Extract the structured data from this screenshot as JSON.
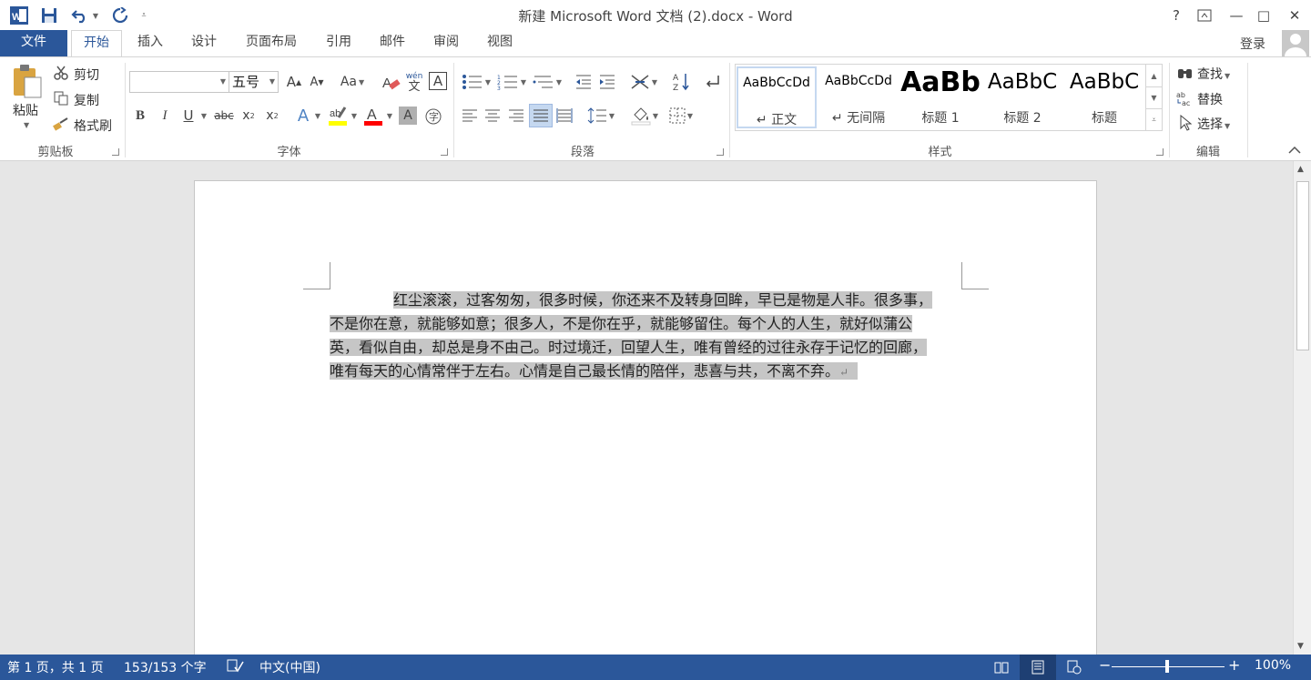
{
  "title": "新建 Microsoft Word 文档 (2).docx - Word",
  "window": {
    "help": "?",
    "minimize": "—",
    "maximize": "□",
    "close": "✕"
  },
  "tabs": [
    {
      "label": "文件"
    },
    {
      "label": "开始"
    },
    {
      "label": "插入"
    },
    {
      "label": "设计"
    },
    {
      "label": "页面布局"
    },
    {
      "label": "引用"
    },
    {
      "label": "邮件"
    },
    {
      "label": "审阅"
    },
    {
      "label": "视图"
    }
  ],
  "account": {
    "login": "登录"
  },
  "clipboard": {
    "group": "剪贴板",
    "paste": "粘贴",
    "cut": "剪切",
    "copy": "复制",
    "format_painter": "格式刷"
  },
  "font": {
    "group": "字体",
    "font_name": "",
    "font_size": "五号",
    "change_case": "Aa",
    "phonetic_top": "wén",
    "phonetic_bottom": "文"
  },
  "paragraph": {
    "group": "段落"
  },
  "styles": {
    "group": "样式",
    "items": [
      {
        "sample": "AaBbCcDd",
        "name": "↵ 正文"
      },
      {
        "sample": "AaBbCcDd",
        "name": "↵ 无间隔"
      },
      {
        "sample": "AaBb",
        "name": "标题 1"
      },
      {
        "sample": "AaBbC",
        "name": "标题 2"
      },
      {
        "sample": "AaBbC",
        "name": "标题"
      }
    ]
  },
  "editing": {
    "group": "编辑",
    "find": "查找",
    "replace": "替换",
    "select": "选择"
  },
  "document": {
    "lines": [
      "红尘滚滚，过客匆匆，很多时候，你还来不及转身回眸，早已是物是人非。很多事，",
      "不是你在意，就能够如意；很多人，不是你在乎，就能够留住。每个人的人生，就好似蒲公",
      "英，看似自由，却总是身不由己。时过境迁，回望人生，唯有曾经的过往永存于记忆的回廊，",
      "唯有每天的心情常伴于左右。心情是自己最长情的陪伴，悲喜与共，不离不弃。"
    ],
    "paragraph_mark": "↵"
  },
  "status": {
    "page": "第 1 页，共 1 页",
    "words": "153/153 个字",
    "language": "中文(中国)",
    "zoom": "100%",
    "zoom_percent": 100
  },
  "colors": {
    "accent": "#2b579a",
    "selection": "#c6c6c6",
    "highlight": "#ffff00",
    "font_color": "#ff0000"
  }
}
